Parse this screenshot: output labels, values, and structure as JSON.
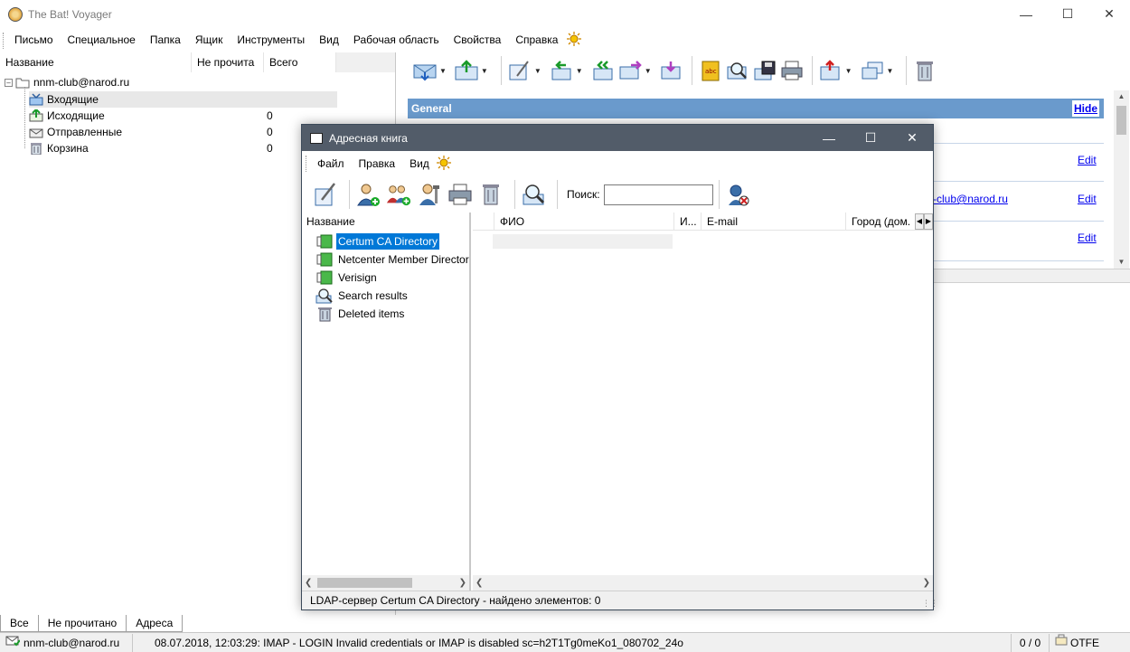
{
  "app": {
    "title": "The Bat! Voyager"
  },
  "menu": [
    "Письмо",
    "Специальное",
    "Папка",
    "Ящик",
    "Инструменты",
    "Вид",
    "Рабочая область",
    "Свойства",
    "Справка"
  ],
  "folder_pane": {
    "columns": [
      "Название",
      "Не прочита",
      "Всего"
    ],
    "account": "nnm-club@narod.ru",
    "folders": [
      {
        "name": "Входящие",
        "unread": "",
        "total": ""
      },
      {
        "name": "Исходящие",
        "unread": "",
        "total": "0"
      },
      {
        "name": "Отправленные",
        "unread": "",
        "total": "0"
      },
      {
        "name": "Корзина",
        "unread": "",
        "total": "0"
      }
    ],
    "tabs": [
      "Все",
      "Не прочитано",
      "Адреса"
    ]
  },
  "preview": {
    "section_title": "General",
    "hide_label": "Hide",
    "email_fragment": "-club@narod.ru",
    "edit_labels": [
      "Edit",
      "Edit",
      "Edit"
    ]
  },
  "statusbar": {
    "account": "nnm-club@narod.ru",
    "message": "08.07.2018, 12:03:29: IMAP  - LOGIN Invalid credentials or IMAP is disabled sc=h2T1Tg0meKo1_080702_24o",
    "counter": "0 / 0",
    "mode": "OTFE"
  },
  "address_book": {
    "title": "Адресная книга",
    "menu": [
      "Файл",
      "Правка",
      "Вид"
    ],
    "search_label": "Поиск:",
    "search_value": "",
    "left_header": "Название",
    "items": [
      {
        "label": "Certum CA Directory",
        "icon": "ldap-directory-icon"
      },
      {
        "label": "Netcenter Member Director",
        "icon": "ldap-directory-icon"
      },
      {
        "label": "Verisign",
        "icon": "ldap-directory-icon"
      },
      {
        "label": "Search results",
        "icon": "search-icon"
      },
      {
        "label": "Deleted items",
        "icon": "trash-icon"
      }
    ],
    "columns": [
      "ФИО",
      "И...",
      "E-mail",
      "Город (дом."
    ],
    "status": "LDAP-сервер Certum CA Directory - найдено элементов: 0"
  }
}
